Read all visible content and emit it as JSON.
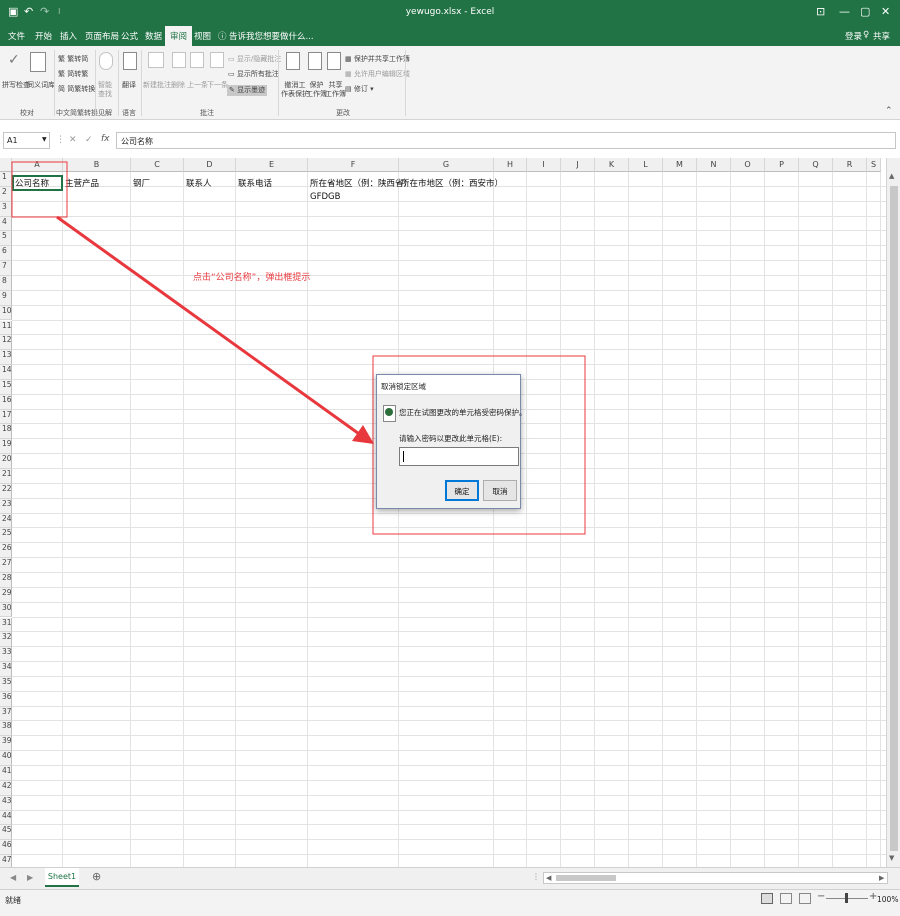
{
  "window": {
    "title": "yewugo.xlsx - Excel",
    "controls": [
      "⊡",
      "—",
      "▢",
      "✕"
    ]
  },
  "quick_access": [
    "save-icon",
    "undo-icon",
    "redo-icon",
    "customize-icon"
  ],
  "menu": {
    "tabs": [
      "文件",
      "开始",
      "插入",
      "页面布局",
      "公式",
      "数据",
      "审阅",
      "视图"
    ],
    "active_tab": "审阅",
    "tell_me": "告诉我您想要做什么...",
    "login": "登录",
    "share": "共享"
  },
  "ribbon": {
    "groups": [
      {
        "label": "校对",
        "buttons": [
          "拼写检查",
          "同义词库"
        ]
      },
      {
        "label": "中文简繁转换",
        "buttons": [
          "繁转简",
          "简转繁",
          "简繁转换"
        ]
      },
      {
        "label": "见解",
        "buttons": [
          "智能",
          "查找"
        ]
      },
      {
        "label": "语言",
        "buttons": [
          "翻译"
        ]
      },
      {
        "label": "批注",
        "buttons": [
          "新建批注",
          "删除",
          "上一条",
          "下一条",
          "显示/隐藏批注",
          "显示所有批注",
          "显示墨迹"
        ]
      },
      {
        "label": "更改",
        "buttons": [
          "撤消工",
          "作表保护",
          "保护",
          "工作簿",
          "共享",
          "工作簿",
          "保护并共享工作簿",
          "允许用户编辑区域",
          "修订 ▾"
        ]
      }
    ]
  },
  "formula_bar": {
    "name_box": "A1",
    "buttons": [
      "✕",
      "✓",
      "fx"
    ],
    "content": "公司名称"
  },
  "columns": [
    "A",
    "B",
    "C",
    "D",
    "E",
    "F",
    "G",
    "H",
    "I",
    "J",
    "K",
    "L",
    "M",
    "N",
    "O",
    "P",
    "Q",
    "R",
    "S"
  ],
  "rows": [
    "1",
    "2",
    "3",
    "4",
    "5",
    "6",
    "7",
    "8",
    "9",
    "10",
    "11",
    "12",
    "13",
    "14",
    "15",
    "16",
    "17",
    "18",
    "19",
    "20",
    "21",
    "22",
    "23",
    "24",
    "25",
    "26",
    "27",
    "28",
    "29",
    "30",
    "31",
    "32",
    "33",
    "34",
    "35",
    "36",
    "37",
    "38",
    "39",
    "40",
    "41",
    "42",
    "43",
    "44",
    "45",
    "46",
    "47"
  ],
  "cells": {
    "A1": "公司名称",
    "B1": "主营产品",
    "C1": "钢厂",
    "D1": "联系人",
    "E1": "联系电话",
    "F1": "所在省地区（例：陕西省）",
    "G1": "所在市地区（例：西安市）",
    "F2": "GFDGB"
  },
  "annotation": {
    "text": "点击“公司名称”，弹出框提示",
    "color": "#e8383d"
  },
  "dialog": {
    "title": "取消锁定区域",
    "message": "您正在试图更改的单元格受密码保护。",
    "prompt": "请输入密码以更改此单元格(E):",
    "password_value": "",
    "ok": "确定",
    "cancel": "取消"
  },
  "sheet_tabs": {
    "tabs": [
      "Sheet1"
    ],
    "add": "⊕"
  },
  "status": {
    "ready": "就绪",
    "zoom": "100%"
  },
  "colors": {
    "excel_green": "#217346",
    "selection": "#217346",
    "annotation_red": "#e8383d"
  }
}
